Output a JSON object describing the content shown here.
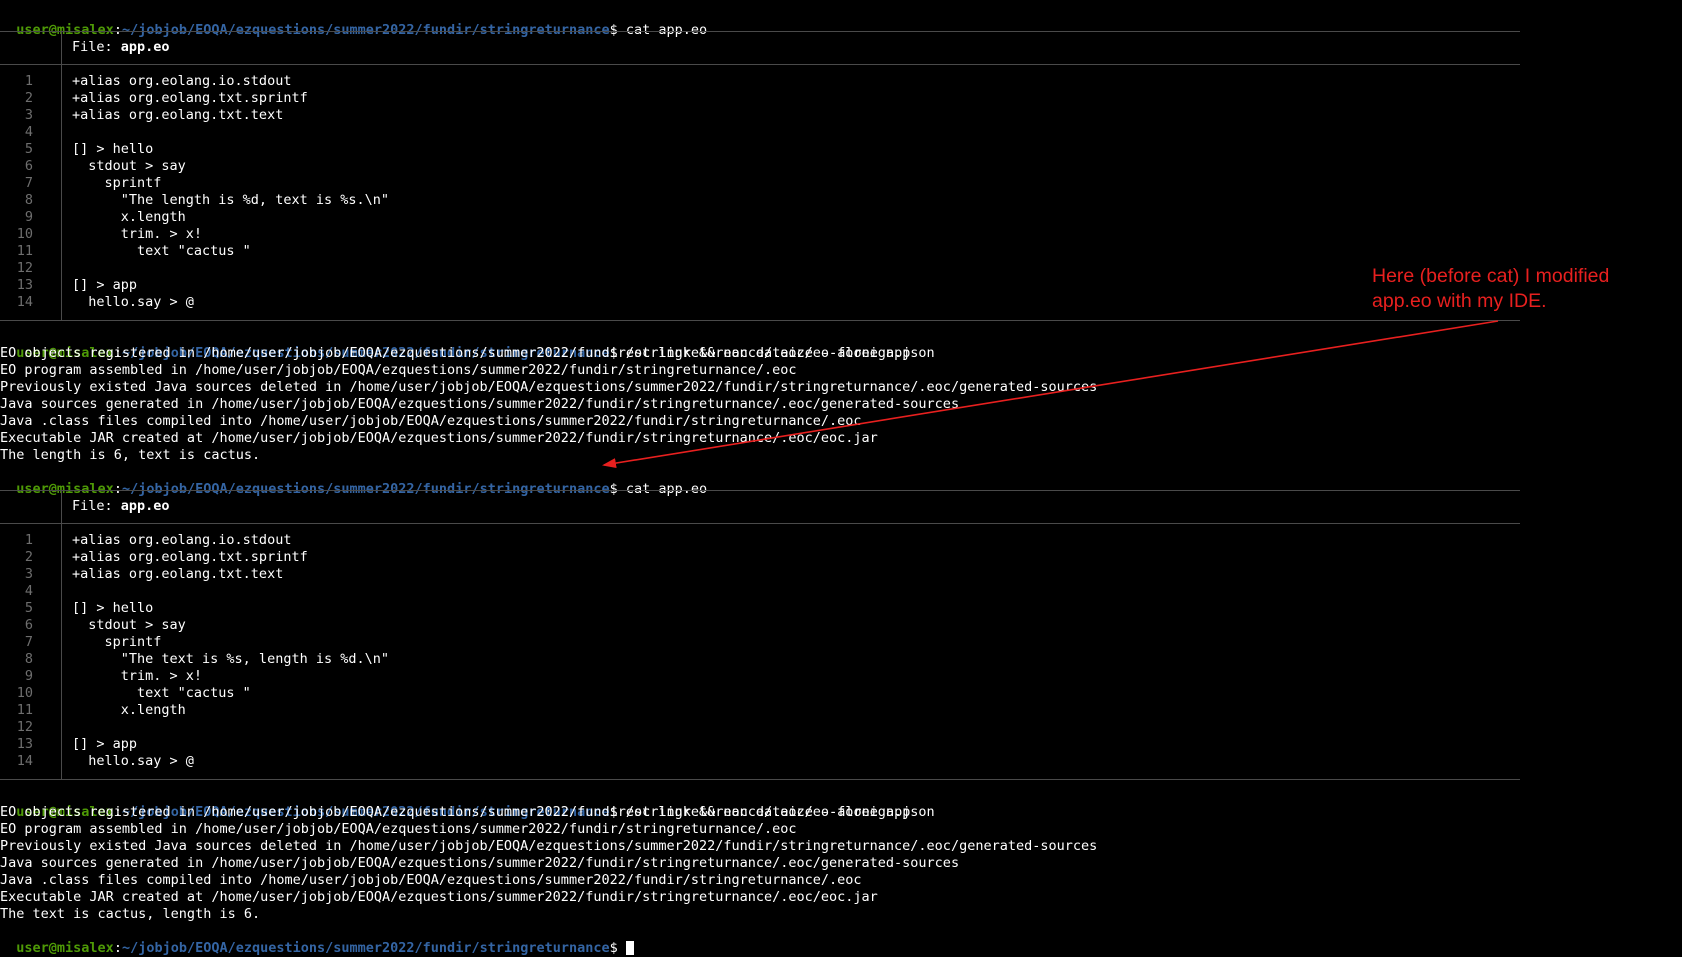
{
  "prompt": {
    "user": "user@misalex",
    "sep": ":",
    "path": "~/jobjob/EOQA/ezquestions/summer2022/fundir/stringreturnance",
    "dollar": "$ "
  },
  "commands": {
    "cat": "cat app.eo",
    "build": "eoc link && eoc dataize --alone app"
  },
  "file_header": {
    "prefix": "File: ",
    "name": "app.eo"
  },
  "block1": {
    "line_numbers": [
      "1",
      "2",
      "3",
      "4",
      "5",
      "6",
      "7",
      "8",
      "9",
      "10",
      "11",
      "12",
      "13",
      "14"
    ],
    "lines": [
      "+alias org.eolang.io.stdout",
      "+alias org.eolang.txt.sprintf",
      "+alias org.eolang.txt.text",
      "",
      "[] > hello",
      "  stdout > say",
      "    sprintf",
      "      \"The length is %d, text is %s.\\n\"",
      "      x.length",
      "      trim. > x!",
      "        text \"cactus \"",
      "",
      "[] > app",
      "  hello.say > @"
    ]
  },
  "block2": {
    "line_numbers": [
      "1",
      "2",
      "3",
      "4",
      "5",
      "6",
      "7",
      "8",
      "9",
      "10",
      "11",
      "12",
      "13",
      "14"
    ],
    "lines": [
      "+alias org.eolang.io.stdout",
      "+alias org.eolang.txt.sprintf",
      "+alias org.eolang.txt.text",
      "",
      "[] > hello",
      "  stdout > say",
      "    sprintf",
      "      \"The text is %s, length is %d.\\n\"",
      "      trim. > x!",
      "        text \"cactus \"",
      "      x.length",
      "",
      "[] > app",
      "  hello.say > @"
    ]
  },
  "build_output": [
    "EO objects registered in /home/user/jobjob/EOQA/ezquestions/summer2022/fundir/stringreturnance/.eoc/eo-foreign.json",
    "EO program assembled in /home/user/jobjob/EOQA/ezquestions/summer2022/fundir/stringreturnance/.eoc",
    "Previously existed Java sources deleted in /home/user/jobjob/EOQA/ezquestions/summer2022/fundir/stringreturnance/.eoc/generated-sources",
    "Java sources generated in /home/user/jobjob/EOQA/ezquestions/summer2022/fundir/stringreturnance/.eoc/generated-sources",
    "Java .class files compiled into /home/user/jobjob/EOQA/ezquestions/summer2022/fundir/stringreturnance/.eoc",
    "Executable JAR created at /home/user/jobjob/EOQA/ezquestions/summer2022/fundir/stringreturnance/.eoc/eoc.jar"
  ],
  "results": {
    "first": "The length is 6, text is cactus.",
    "second": "The text is cactus, length is 6."
  },
  "annotation": {
    "line1": "Here (before cat) I modified",
    "line2": "app.eo with my IDE."
  },
  "colors": {
    "background": "#000000",
    "prompt_user": "#4e9a06",
    "prompt_path": "#3465a4",
    "annotation": "#e8201f"
  }
}
